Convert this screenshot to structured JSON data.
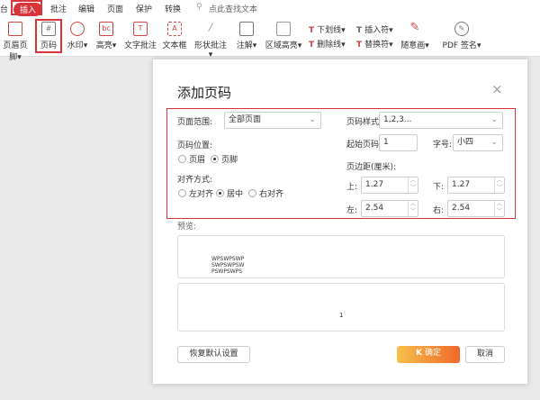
{
  "menu_tabs": [
    "台",
    "插入",
    "批注",
    "编辑",
    "页面",
    "保护",
    "转换"
  ],
  "search_placeholder": "点此查找文本",
  "ribbon": {
    "header_footer": "页眉页脚",
    "page_number": "页码",
    "watermark": "水印",
    "highlight": "高亮",
    "text_comment": "文字批注",
    "text_box": "文本框",
    "shape_comment": "形状批注",
    "annotation": "注解",
    "area_highlight": "区域高亮",
    "underline": "下划线",
    "strikethrough": "删除线",
    "insert_mark": "插入符",
    "replace_mark": "替换符",
    "freehand": "随意画",
    "pdf_sign": "PDF 签名"
  },
  "dialog": {
    "title": "添加页码",
    "page_range_label": "页面范围:",
    "page_range_value": "全部页面",
    "position_label": "页码位置:",
    "position_options": [
      "页眉",
      "页脚"
    ],
    "position_selected": "页脚",
    "align_label": "对齐方式:",
    "align_options": [
      "左对齐",
      "居中",
      "右对齐"
    ],
    "align_selected": "居中",
    "style_label": "页码样式:",
    "style_value": "1,2,3...",
    "start_label": "起始页码:",
    "start_value": "1",
    "font_size_label": "字号:",
    "font_size_value": "小四",
    "margin_label": "页边距(厘米):",
    "top_label": "上:",
    "top_value": "1.27",
    "bottom_label": "下:",
    "bottom_value": "1.27",
    "left_label": "左:",
    "left_value": "2.54",
    "right_label": "右:",
    "right_value": "2.54",
    "preview_label": "预览:",
    "preview_text": [
      "WPSWPSWP",
      "SWPSWPSW",
      "PSWPSWPS"
    ],
    "preview_number": "1",
    "restore_button": "恢复默认设置",
    "ok_button": "确定",
    "cancel_button": "取消"
  },
  "colors": {
    "accent": "#d8343a",
    "ok_start": "#f7c04a",
    "ok_end": "#f0682a"
  }
}
